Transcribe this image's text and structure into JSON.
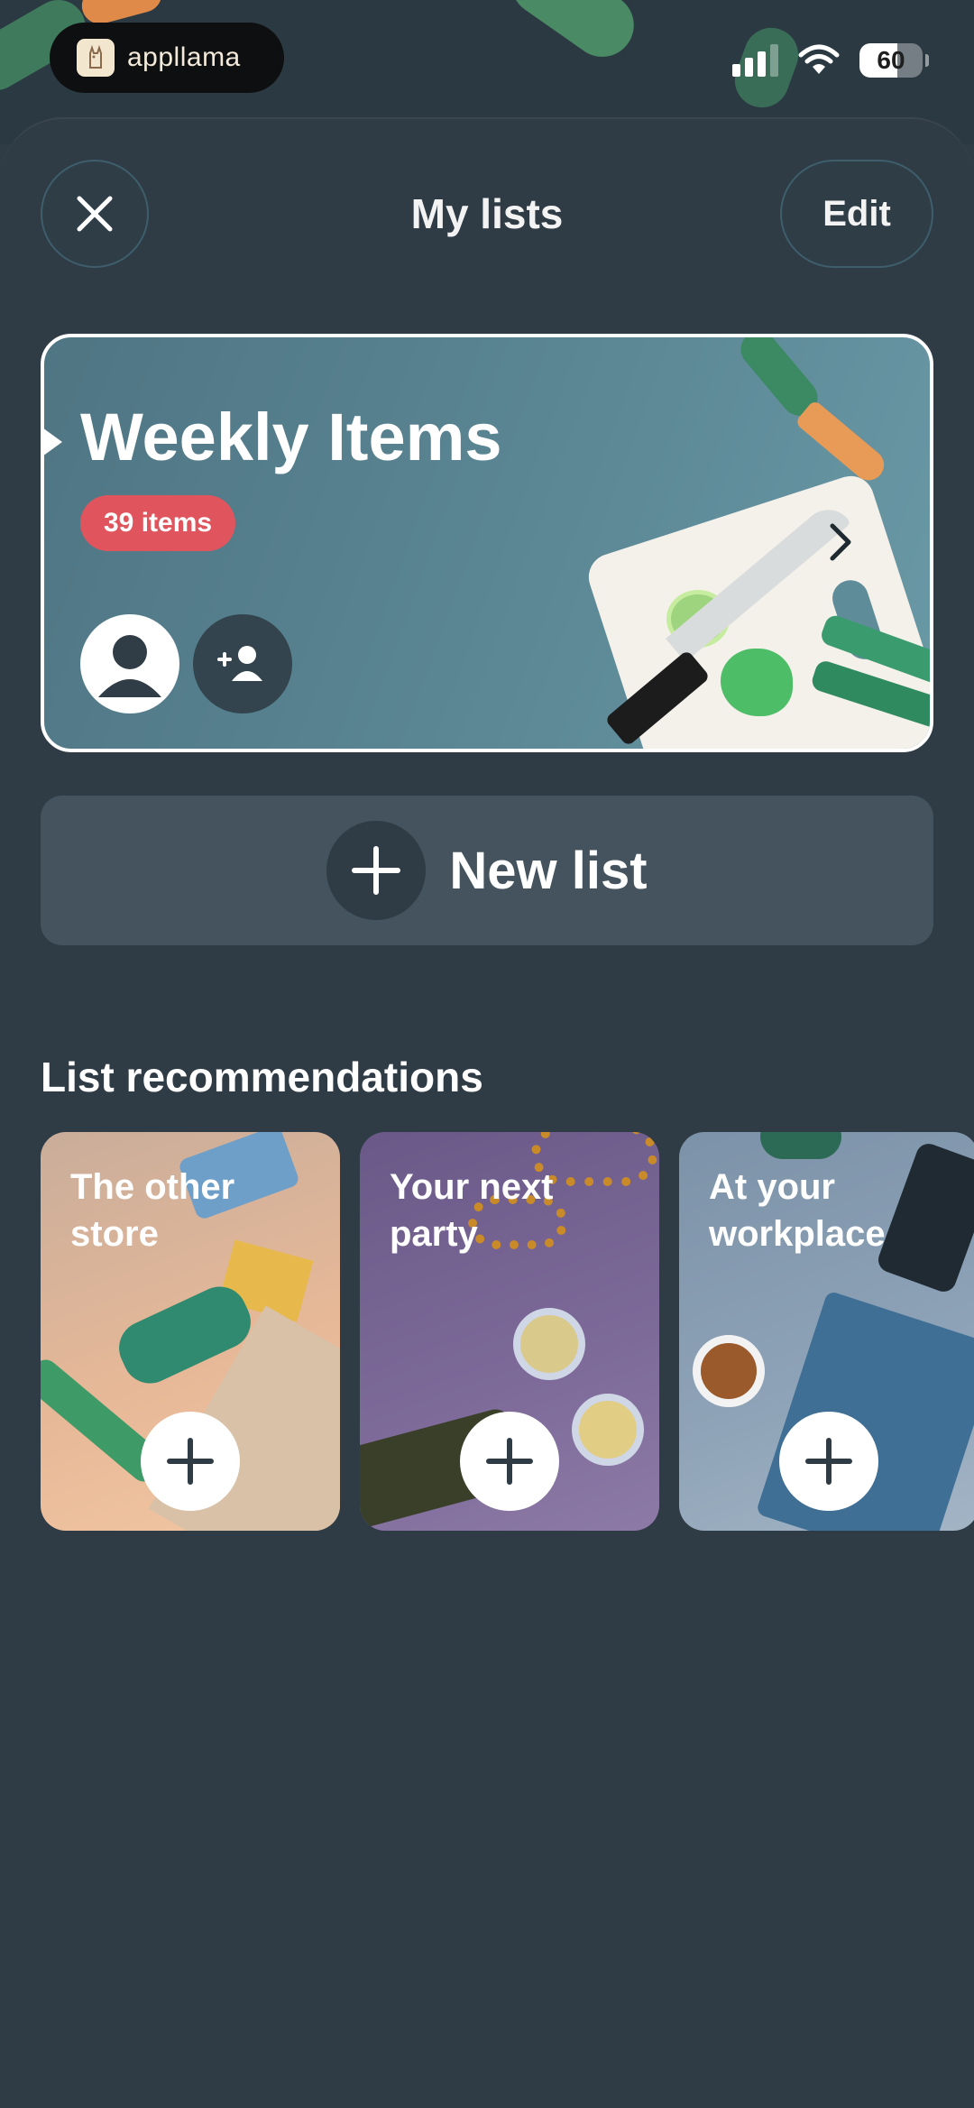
{
  "status_bar": {
    "island_app_name": "appllama",
    "battery_level": "60",
    "battery_fraction": 0.6
  },
  "header": {
    "title": "My lists",
    "edit_label": "Edit"
  },
  "list_card": {
    "title": "Weekly Items",
    "count_badge": "39 items"
  },
  "new_list": {
    "label": "New list"
  },
  "recommendations": {
    "title": "List recommendations",
    "items": [
      {
        "label": "The other store"
      },
      {
        "label": "Your next party"
      },
      {
        "label": "At your workplace"
      }
    ]
  },
  "colors": {
    "background": "#2f3b45",
    "badge": "#e0555d",
    "card_border": "#ffffff"
  }
}
